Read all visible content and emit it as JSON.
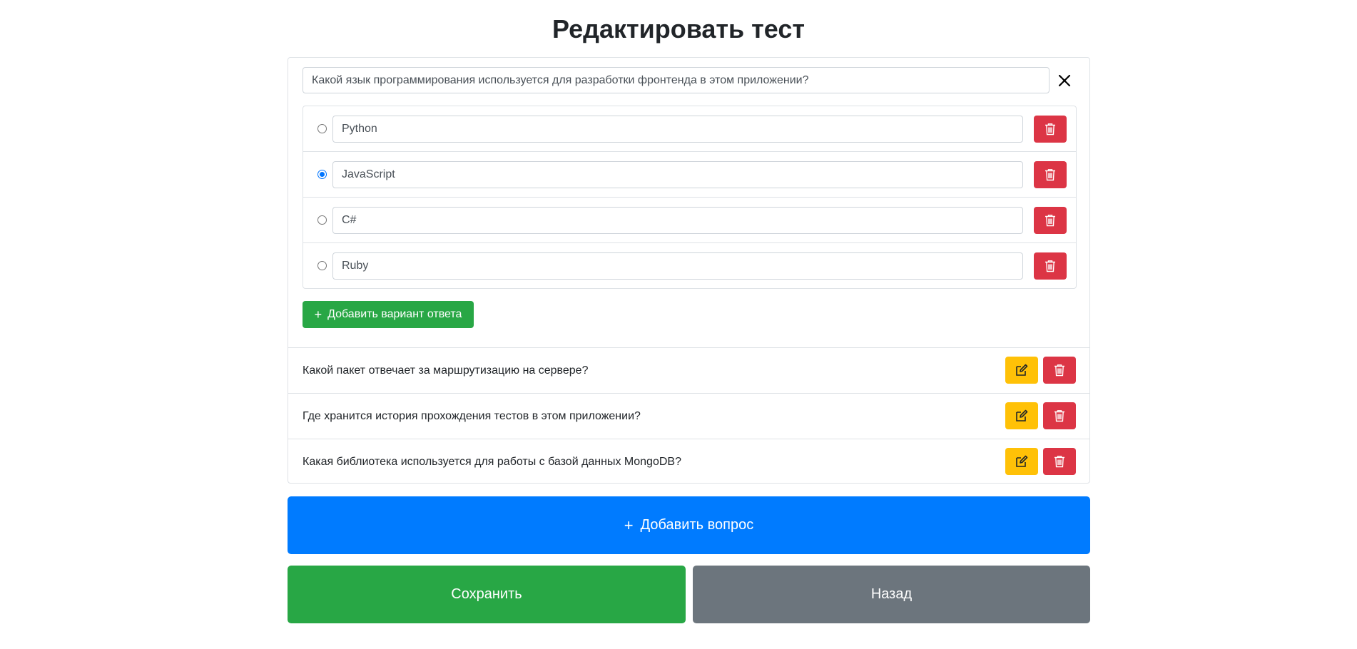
{
  "page": {
    "title": "Редактировать тест"
  },
  "editing_question": {
    "text": "Какой язык программирования используется для разработки фронтенда в этом приложении?",
    "answers": [
      {
        "text": "Python",
        "selected": false
      },
      {
        "text": "JavaScript",
        "selected": true
      },
      {
        "text": "C#",
        "selected": false
      },
      {
        "text": "Ruby",
        "selected": false
      }
    ],
    "add_answer_label": "Добавить вариант ответа"
  },
  "questions": [
    {
      "text": "Какой пакет отвечает за маршрутизацию на сервере?"
    },
    {
      "text": "Где хранится история прохождения тестов в этом приложении?"
    },
    {
      "text": "Какая библиотека используется для работы с базой данных MongoDB?"
    }
  ],
  "actions": {
    "add_question_label": "Добавить вопрос",
    "save_label": "Сохранить",
    "back_label": "Назад"
  },
  "icons": {
    "close": "close-icon",
    "trash": "trash-icon",
    "edit": "edit-icon",
    "plus": "plus-icon"
  },
  "colors": {
    "primary": "#007bff",
    "success": "#28a745",
    "danger": "#dc3545",
    "warning": "#ffc107",
    "secondary": "#6c757d"
  }
}
